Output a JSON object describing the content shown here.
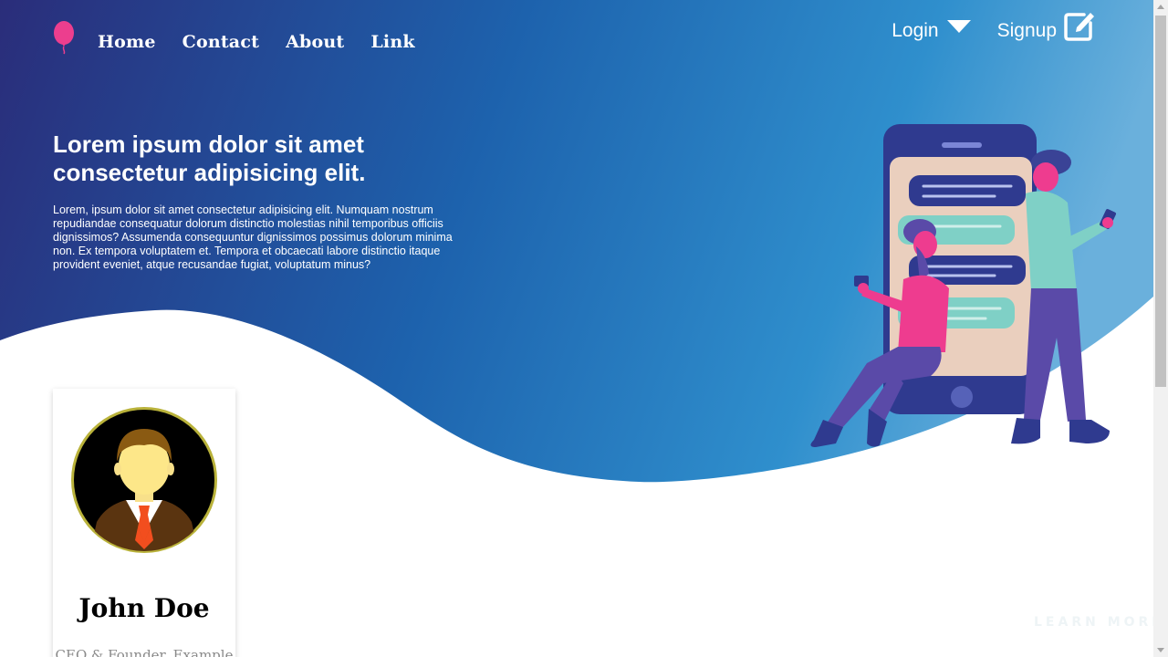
{
  "nav": {
    "links": [
      {
        "label": "Home"
      },
      {
        "label": "Contact"
      },
      {
        "label": "About"
      },
      {
        "label": "Link"
      }
    ],
    "login_label": "Login",
    "signup_label": "Signup"
  },
  "hero": {
    "title": "Lorem ipsum dolor sit amet consectetur adipisicing elit.",
    "text": "Lorem, ipsum dolor sit amet consectetur adipisicing elit. Numquam nostrum repudiandae consequatur dolorum distinctio molestias nihil temporibus officiis dignissimos? Assumenda consequuntur dignissimos possimus dolorum minima non. Ex tempora voluptatem et. Tempora et obcaecati labore distinctio itaque provident eveniet, atque recusandae fugiat, voluptatum minus?"
  },
  "card": {
    "name": "John Doe",
    "role": "CEO & Founder, Example"
  },
  "learn_more": "LEARN MORE",
  "colors": {
    "gradient_start": "#2a2f7c",
    "gradient_mid": "#1f6cb6",
    "gradient_end": "#6fb0db",
    "logo_pink": "#ec3e8e"
  },
  "icons": {
    "logo": "balloon-icon",
    "login": "caret-down-icon",
    "signup": "edit-icon"
  }
}
